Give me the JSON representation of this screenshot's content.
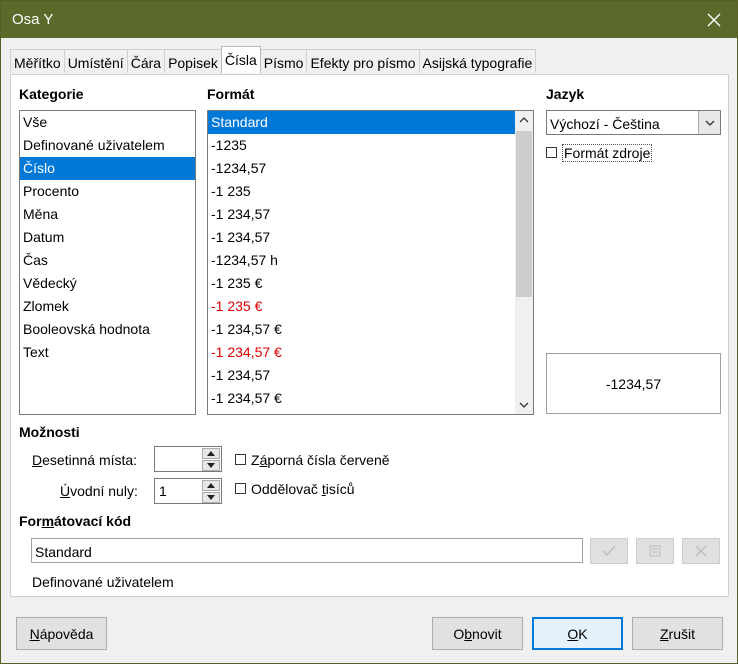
{
  "window": {
    "title": "Osa Y"
  },
  "tabs": [
    {
      "label": "Měřítko"
    },
    {
      "label": "Umístění"
    },
    {
      "label": "Čára"
    },
    {
      "label": "Popisek"
    },
    {
      "label": "Čísla"
    },
    {
      "label": "Písmo"
    },
    {
      "label": "Efekty pro písmo"
    },
    {
      "label": "Asijská typografie"
    }
  ],
  "active_tab": "Čísla",
  "category": {
    "label": "Kategorie",
    "items": [
      "Vše",
      "Definované uživatelem",
      "Číslo",
      "Procento",
      "Měna",
      "Datum",
      "Čas",
      "Vědecký",
      "Zlomek",
      "Booleovská hodnota",
      "Text"
    ],
    "selected": "Číslo"
  },
  "format": {
    "label": "Formát",
    "items": [
      {
        "text": "Standard",
        "selected": true,
        "red": false
      },
      {
        "text": "-1235",
        "selected": false,
        "red": false
      },
      {
        "text": "-1234,57",
        "selected": false,
        "red": false
      },
      {
        "text": "-1 235",
        "selected": false,
        "red": false
      },
      {
        "text": "-1 234,57",
        "selected": false,
        "red": false
      },
      {
        "text": "-1 234,57",
        "selected": false,
        "red": false
      },
      {
        "text": "-1234,57 h",
        "selected": false,
        "red": false
      },
      {
        "text": "-1 235 €",
        "selected": false,
        "red": false
      },
      {
        "text": "-1 235 €",
        "selected": false,
        "red": true
      },
      {
        "text": "-1 234,57 €",
        "selected": false,
        "red": false
      },
      {
        "text": "-1 234,57 €",
        "selected": false,
        "red": true
      },
      {
        "text": "-1 234,57",
        "selected": false,
        "red": false
      },
      {
        "text": "-1 234,57 €",
        "selected": false,
        "red": false
      }
    ]
  },
  "language": {
    "label": "Jazyk",
    "value": "Výchozí - Čeština",
    "source_format_label": "Formát zdroje",
    "source_format_checked": false
  },
  "preview": {
    "value": "-1234,57"
  },
  "options": {
    "label": "Možnosti",
    "decimal_places_label": "Desetinná místa:",
    "decimal_places_value": "",
    "leading_zeros_label": "Úvodní nuly:",
    "leading_zeros_value": "1",
    "negative_red_label": "Záporná čísla červeně",
    "negative_red_checked": false,
    "thousands_sep_label": "Oddělovač tisíců",
    "thousands_sep_checked": false
  },
  "format_code": {
    "label": "Formátovací kód",
    "value": "Standard",
    "description": "Definované uživatelem"
  },
  "buttons": {
    "help": "Nápověda",
    "reset": "Obnovit",
    "ok": "OK",
    "cancel": "Zrušit"
  },
  "colors": {
    "titlebar": "#5b6a2b",
    "selection": "#0078d7",
    "negative_red": "#e00000"
  }
}
